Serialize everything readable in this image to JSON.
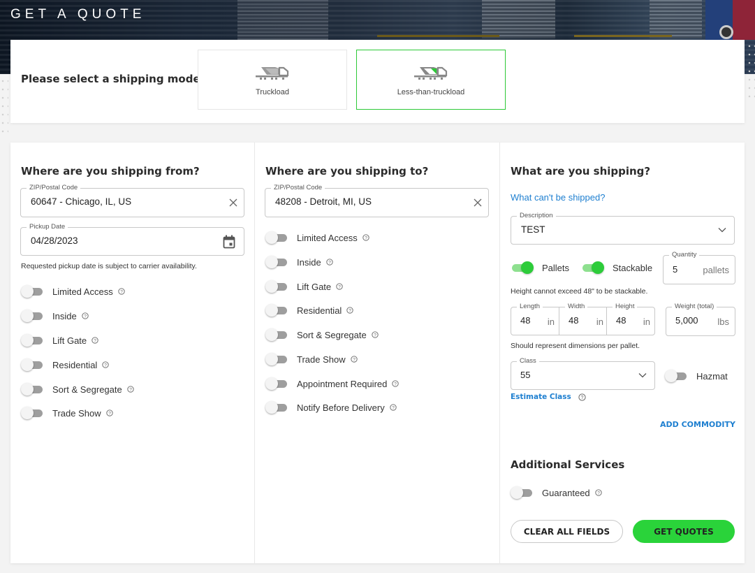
{
  "header": {
    "title": "GET A QUOTE"
  },
  "mode_selector": {
    "prompt": "Please select a shipping mode.",
    "options": [
      {
        "label": "Truckload",
        "icon": "truck-icon",
        "selected": false
      },
      {
        "label": "Less-than-truckload",
        "icon": "ltl-truck-icon",
        "selected": true
      }
    ],
    "accent_color": "#2dc937"
  },
  "origin": {
    "title": "Where are you shipping from?",
    "zip": {
      "label": "ZIP/Postal Code",
      "value": "60647 - Chicago, IL, US"
    },
    "pickup_date": {
      "label": "Pickup Date",
      "value": "04/28/2023"
    },
    "date_note": "Requested pickup date is subject to carrier availability.",
    "services": [
      {
        "label": "Limited Access",
        "on": false
      },
      {
        "label": "Inside",
        "on": false
      },
      {
        "label": "Lift Gate",
        "on": false
      },
      {
        "label": "Residential",
        "on": false
      },
      {
        "label": "Sort & Segregate",
        "on": false
      },
      {
        "label": "Trade Show",
        "on": false
      }
    ]
  },
  "destination": {
    "title": "Where are you shipping to?",
    "zip": {
      "label": "ZIP/Postal Code",
      "value": "48208 - Detroit, MI, US"
    },
    "services": [
      {
        "label": "Limited Access",
        "on": false
      },
      {
        "label": "Inside",
        "on": false
      },
      {
        "label": "Lift Gate",
        "on": false
      },
      {
        "label": "Residential",
        "on": false
      },
      {
        "label": "Sort & Segregate",
        "on": false
      },
      {
        "label": "Trade Show",
        "on": false
      },
      {
        "label": "Appointment Required",
        "on": false
      },
      {
        "label": "Notify Before Delivery",
        "on": false
      }
    ]
  },
  "commodity": {
    "title": "What are you shipping?",
    "restricted_link": "What can't be shipped?",
    "description": {
      "label": "Description",
      "value": "TEST"
    },
    "pallets_toggle": {
      "label": "Pallets",
      "on": true
    },
    "stackable_toggle": {
      "label": "Stackable",
      "on": true
    },
    "quantity": {
      "label": "Quantity",
      "value": "5",
      "unit": "pallets"
    },
    "stack_note": "Height cannot exceed 48\" to be stackable.",
    "length": {
      "label": "Length",
      "value": "48",
      "unit": "in"
    },
    "width": {
      "label": "Width",
      "value": "48",
      "unit": "in"
    },
    "height": {
      "label": "Height",
      "value": "48",
      "unit": "in"
    },
    "weight": {
      "label": "Weight (total)",
      "value": "5,000",
      "unit": "lbs"
    },
    "dims_note": "Should represent dimensions per pallet.",
    "class": {
      "label": "Class",
      "value": "55"
    },
    "hazmat_toggle": {
      "label": "Hazmat",
      "on": false
    },
    "estimate_class_link": "Estimate Class",
    "add_commodity": "ADD COMMODITY"
  },
  "additional_services": {
    "title": "Additional Services",
    "services": [
      {
        "label": "Guaranteed",
        "on": false
      }
    ]
  },
  "actions": {
    "clear_label": "CLEAR ALL FIELDS",
    "submit_label": "GET QUOTES",
    "submit_color": "#2ad33a",
    "link_color": "#1e7fd0"
  }
}
